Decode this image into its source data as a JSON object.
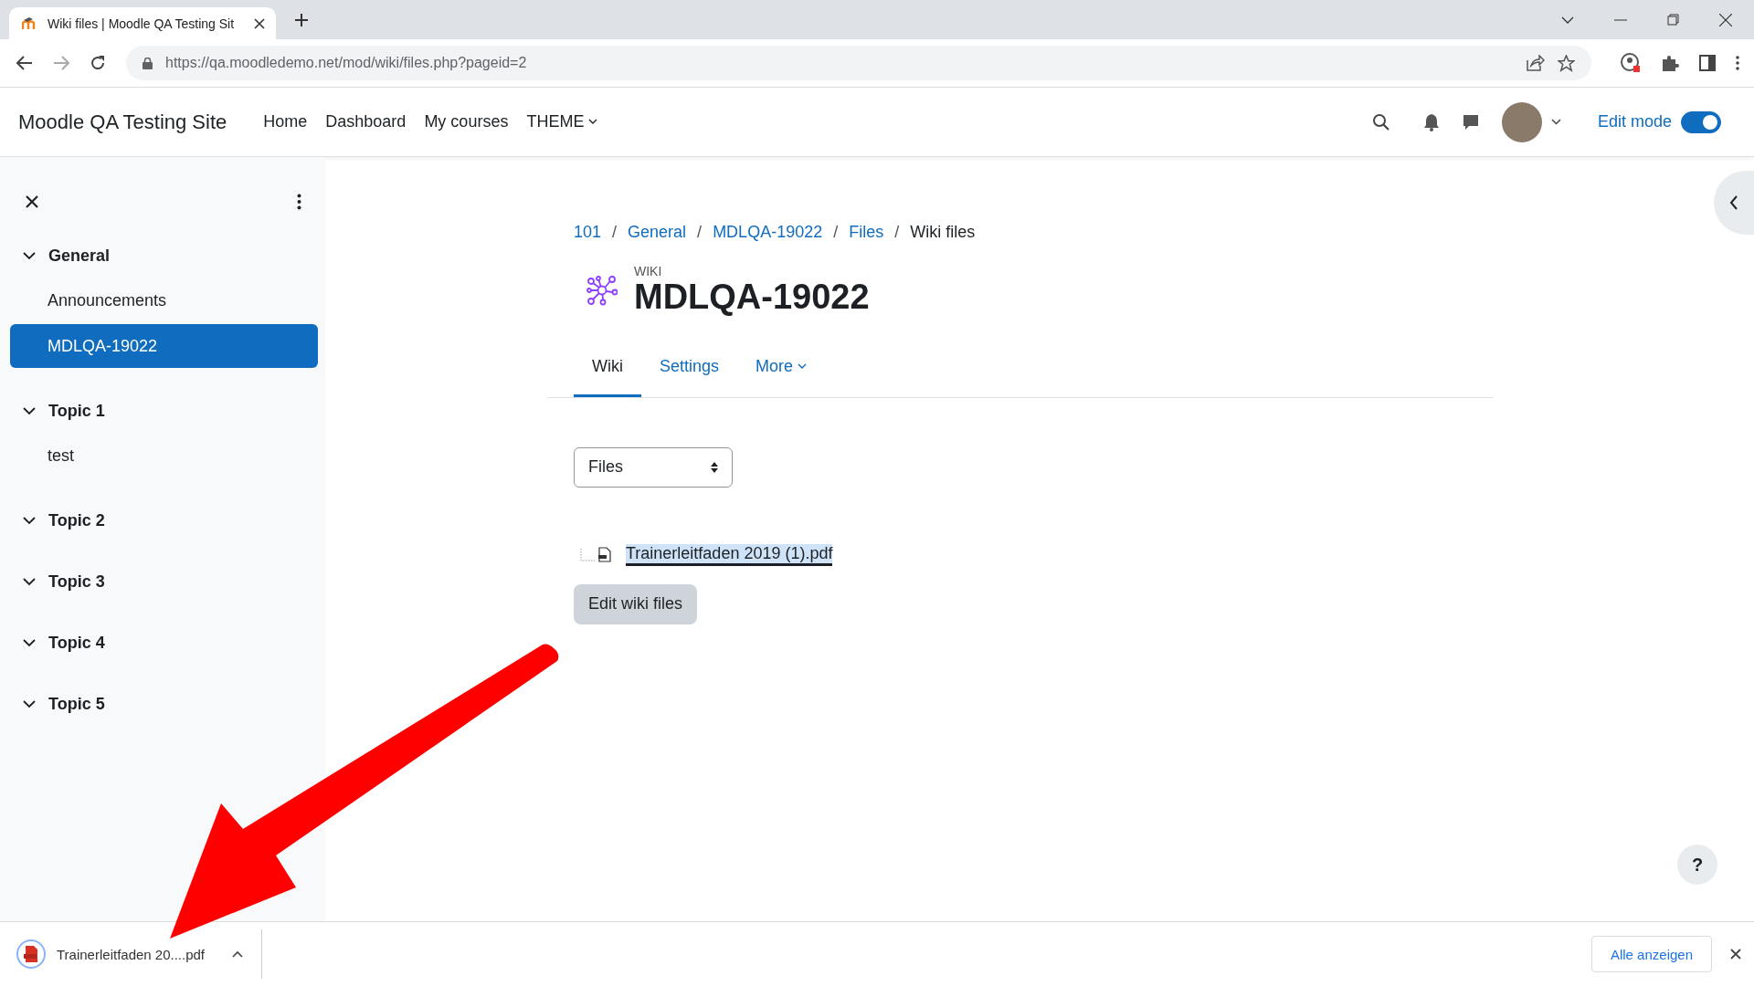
{
  "browser": {
    "tab_title": "Wiki files | Moodle QA Testing Sit",
    "url": "https://qa.moodledemo.net/mod/wiki/files.php?pageid=2"
  },
  "navbar": {
    "site_name": "Moodle QA Testing Site",
    "items": [
      {
        "label": "Home",
        "kind": "link"
      },
      {
        "label": "Dashboard",
        "kind": "link"
      },
      {
        "label": "My courses",
        "kind": "link"
      },
      {
        "label": "THEME",
        "kind": "dropdown"
      }
    ],
    "edit_mode": {
      "label": "Edit mode",
      "on": true
    }
  },
  "sidebar": {
    "sections": [
      {
        "title": "General",
        "expanded": true,
        "children": [
          {
            "label": "Announcements",
            "selected": false
          },
          {
            "label": "MDLQA-19022",
            "selected": true
          }
        ]
      },
      {
        "title": "Topic 1",
        "expanded": true,
        "children": [
          {
            "label": "test",
            "selected": false
          }
        ]
      },
      {
        "title": "Topic 2",
        "expanded": true
      },
      {
        "title": "Topic 3",
        "expanded": true
      },
      {
        "title": "Topic 4",
        "expanded": true
      },
      {
        "title": "Topic 5",
        "expanded": true
      }
    ]
  },
  "breadcrumb": {
    "separator": "/",
    "items": [
      {
        "label": "101",
        "current": false
      },
      {
        "label": "General",
        "current": false
      },
      {
        "label": "MDLQA-19022",
        "current": false
      },
      {
        "label": "Files",
        "current": false
      },
      {
        "label": "Wiki files",
        "current": true
      }
    ]
  },
  "activity": {
    "type_label": "WIKI",
    "title": "MDLQA-19022"
  },
  "tabs": [
    {
      "label": "Wiki",
      "selected": true,
      "kind": "tab"
    },
    {
      "label": "Settings",
      "selected": false,
      "kind": "tab"
    },
    {
      "label": "More",
      "selected": false,
      "kind": "dropdown"
    }
  ],
  "view_select": {
    "value": "Files"
  },
  "files": [
    {
      "name": "Trainerleitfaden 2019 (1).pdf",
      "highlighted": true
    }
  ],
  "edit_button": "Edit wiki files",
  "help_button": "?",
  "download_bar": {
    "file": "Trainerleitfaden 20....pdf",
    "show_all": "Alle anzeigen"
  }
}
